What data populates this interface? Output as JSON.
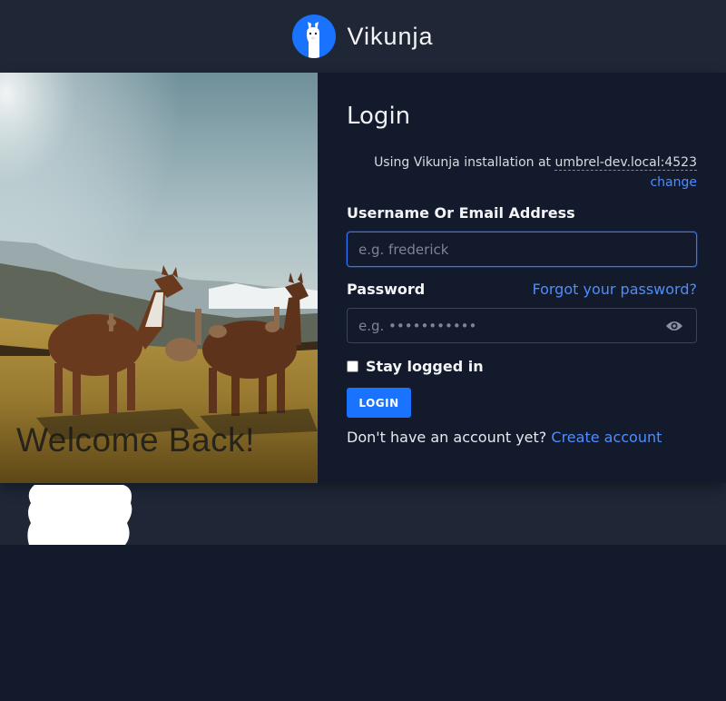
{
  "header": {
    "brand_name": "Vikunja",
    "logo_icon": "llama-logo-icon",
    "accent_color": "#1973ff"
  },
  "hero": {
    "welcome_text": "Welcome Back!"
  },
  "login": {
    "title": "Login",
    "installation_prefix": "Using Vikunja installation at",
    "installation_url": "umbrel-dev.local:4523",
    "change_link": "change",
    "username_label": "Username Or Email Address",
    "username_placeholder": "e.g. frederick",
    "username_value": "",
    "password_label": "Password",
    "password_placeholder": "e.g. •••••••••••",
    "password_value": "",
    "password_toggle_icon": "eye-icon",
    "forgot_link": "Forgot your password?",
    "stay_logged_in_label": "Stay logged in",
    "stay_logged_in_checked": false,
    "login_button": "LOGIN",
    "signup_prompt": "Don't have an account yet?",
    "signup_link": "Create account"
  }
}
